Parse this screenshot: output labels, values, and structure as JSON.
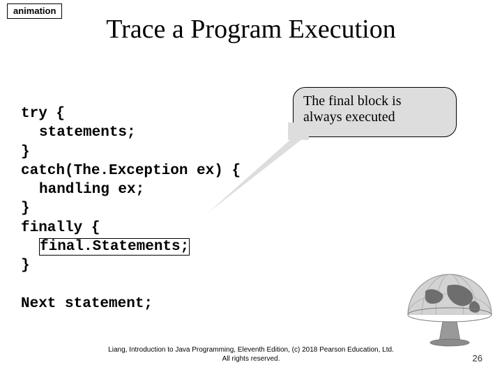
{
  "tag": "animation",
  "title": "Trace a Program Execution",
  "callout": {
    "line1": "The final block is",
    "line2": "always executed"
  },
  "code": {
    "l1": "try {",
    "l2": "statements;",
    "l3": "}",
    "l4": "catch(The.Exception ex) {",
    "l5": "handling ex;",
    "l6": "}",
    "l7": "finally {",
    "l8": "final.Statements;",
    "l9": "}",
    "blank": "",
    "l10": "Next statement;"
  },
  "footer": {
    "line1": "Liang, Introduction to Java Programming, Eleventh Edition, (c) 2018 Pearson Education, Ltd.",
    "line2": "All rights reserved."
  },
  "pagenum": "26"
}
